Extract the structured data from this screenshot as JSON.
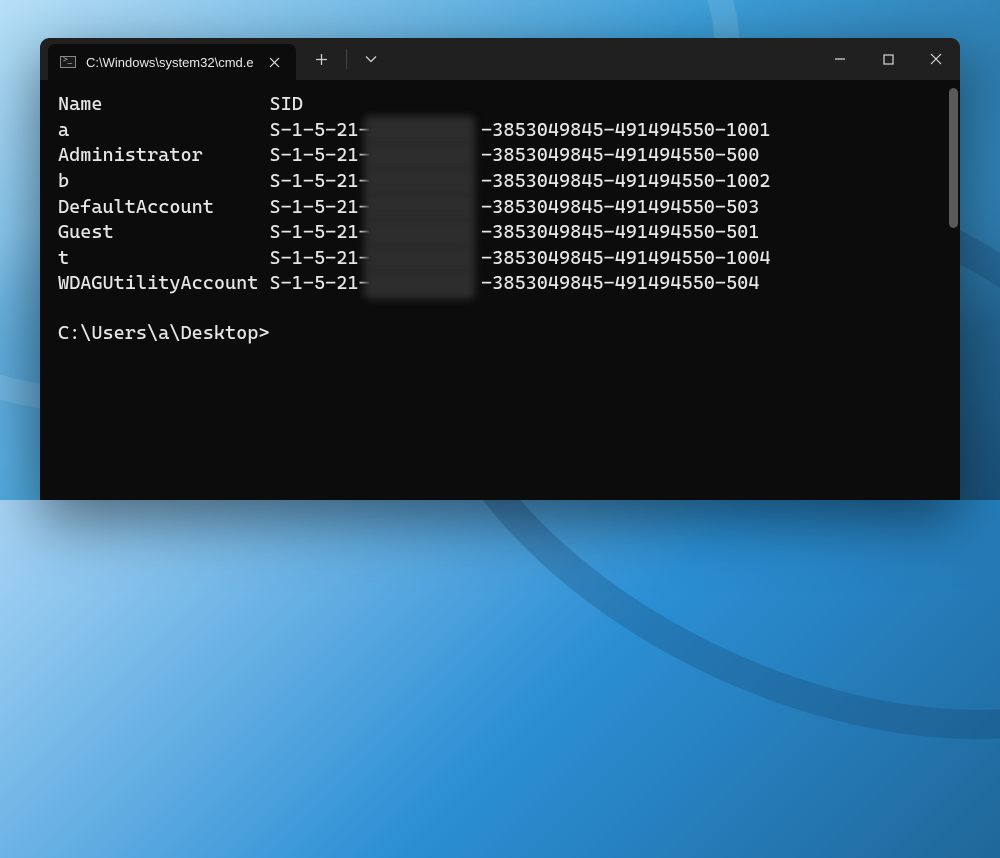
{
  "window": {
    "tab_title": "C:\\Windows\\system32\\cmd.e",
    "controls": {
      "minimize": "—",
      "maximize": "▢",
      "close": "✕"
    }
  },
  "output": {
    "headers": {
      "name": "Name",
      "sid": "SID"
    },
    "rows": [
      {
        "name": "a",
        "sid_prefix": "S-1-5-21-",
        "sid_hidden": "XXXXXXXXXX",
        "sid_suffix": "-3853049845-491494550-1001"
      },
      {
        "name": "Administrator",
        "sid_prefix": "S-1-5-21-",
        "sid_hidden": "XXXXXXXXXX",
        "sid_suffix": "-3853049845-491494550-500"
      },
      {
        "name": "b",
        "sid_prefix": "S-1-5-21-",
        "sid_hidden": "XXXXXXXXXX",
        "sid_suffix": "-3853049845-491494550-1002"
      },
      {
        "name": "DefaultAccount",
        "sid_prefix": "S-1-5-21-",
        "sid_hidden": "XXXXXXXXXX",
        "sid_suffix": "-3853049845-491494550-503"
      },
      {
        "name": "Guest",
        "sid_prefix": "S-1-5-21-",
        "sid_hidden": "XXXXXXXXXX",
        "sid_suffix": "-3853049845-491494550-501"
      },
      {
        "name": "t",
        "sid_prefix": "S-1-5-21-",
        "sid_hidden": "XXXXXXXXXX",
        "sid_suffix": "-3853049845-491494550-1004"
      },
      {
        "name": "WDAGUtilityAccount",
        "sid_prefix": "S-1-5-21-",
        "sid_hidden": "XXXXXXXXXX",
        "sid_suffix": "-3853049845-491494550-504"
      }
    ]
  },
  "prompt": "C:\\Users\\a\\Desktop>"
}
